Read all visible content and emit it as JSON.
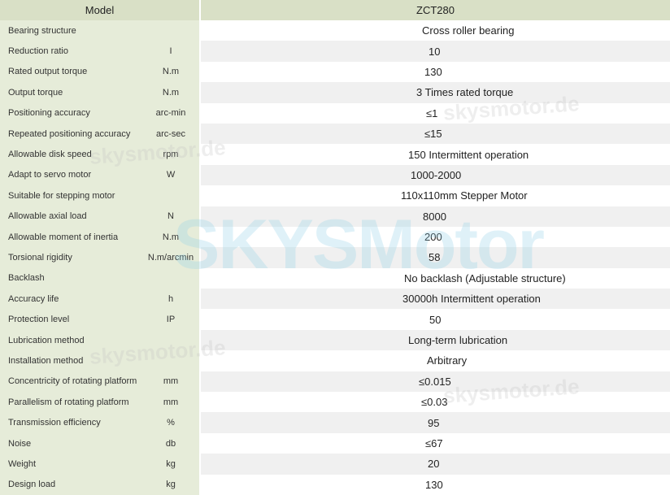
{
  "header": {
    "model_label": "Model",
    "model_value": "ZCT280"
  },
  "rows": [
    {
      "param": "Bearing structure",
      "unit": "",
      "value": "Cross roller bearing"
    },
    {
      "param": "Reduction ratio",
      "unit": "I",
      "value": "10"
    },
    {
      "param": "Rated output torque",
      "unit": "N.m",
      "value": "130"
    },
    {
      "param": "Output torque",
      "unit": "N.m",
      "value": "3 Times rated torque"
    },
    {
      "param": "Positioning accuracy",
      "unit": "arc-min",
      "value": "≤1"
    },
    {
      "param": "Repeated positioning accuracy",
      "unit": "arc-sec",
      "value": "≤15"
    },
    {
      "param": "Allowable disk speed",
      "unit": "rpm",
      "value": "150 Intermittent operation"
    },
    {
      "param": "Adapt to servo motor",
      "unit": "W",
      "value": "1000-2000"
    },
    {
      "param": "Suitable for stepping motor",
      "unit": "",
      "value": "110x110mm Stepper Motor"
    },
    {
      "param": "Allowable axial load",
      "unit": "N",
      "value": "8000"
    },
    {
      "param": "Allowable moment of inertia",
      "unit": "N.m",
      "value": "200"
    },
    {
      "param": "Torsional rigidity",
      "unit": "N.m/arcmin",
      "value": "58"
    },
    {
      "param": "Backlash",
      "unit": "",
      "value": "No backlash (Adjustable structure)"
    },
    {
      "param": "Accuracy life",
      "unit": "h",
      "value": "30000h Intermittent operation"
    },
    {
      "param": "Protection level",
      "unit": "IP",
      "value": "50"
    },
    {
      "param": "Lubrication method",
      "unit": "",
      "value": "Long-term lubrication"
    },
    {
      "param": "Installation method",
      "unit": "",
      "value": "Arbitrary"
    },
    {
      "param": "Concentricity of rotating platform",
      "unit": "mm",
      "value": "≤0.015"
    },
    {
      "param": "Parallelism of rotating platform",
      "unit": "mm",
      "value": "≤0.03"
    },
    {
      "param": "Transmission efficiency",
      "unit": "%",
      "value": "95"
    },
    {
      "param": "Noise",
      "unit": "db",
      "value": "≤67"
    },
    {
      "param": "Weight",
      "unit": "kg",
      "value": "20"
    },
    {
      "param": "Design load",
      "unit": "kg",
      "value": "130"
    }
  ],
  "watermark": {
    "main": "SKYSMotor",
    "small": "skysmotor.de"
  },
  "colors": {
    "label_bg": "#e6ecd9",
    "header_bg": "#d9e0c6",
    "stripe_bg": "#f0f0f0",
    "watermark": "#8fd0e8"
  }
}
